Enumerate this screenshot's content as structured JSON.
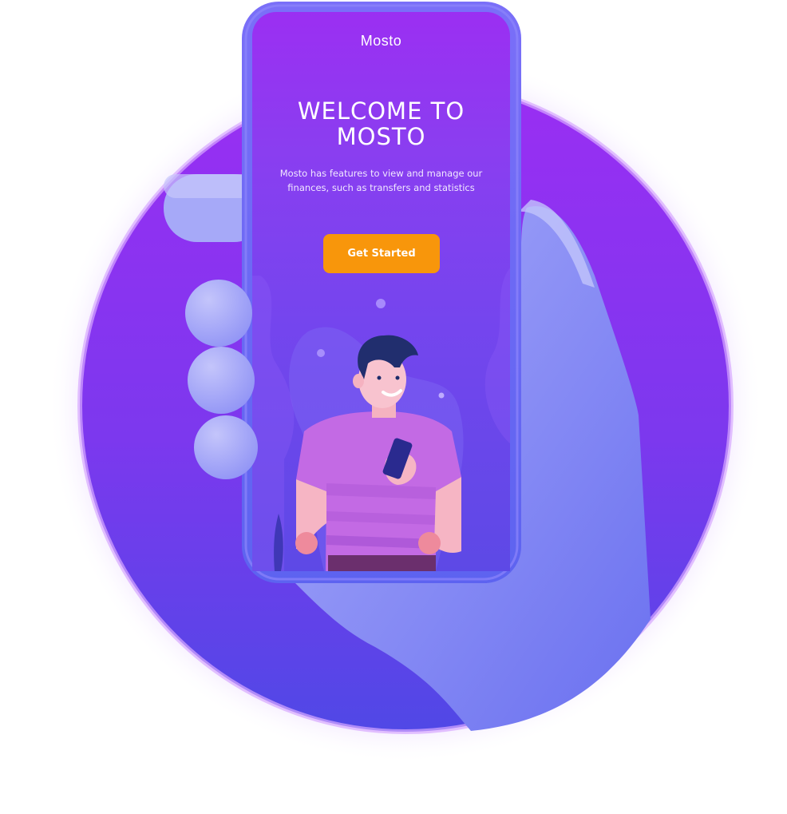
{
  "app": {
    "name": "Mosto"
  },
  "welcome": {
    "headline_line1": "WELCOME TO",
    "headline_line2": "MOSTO",
    "description": "Mosto has features to view and manage our finances, such as transfers and statistics",
    "cta_label": "Get Started"
  },
  "colors": {
    "accent": "#f8960b",
    "screen_top": "#9b2ff2",
    "screen_bottom": "#5d49e6",
    "circle": "#8a30f0",
    "hand": "#7b7ff5"
  },
  "icons": {
    "illustration": "person-holding-phone-illustration"
  }
}
